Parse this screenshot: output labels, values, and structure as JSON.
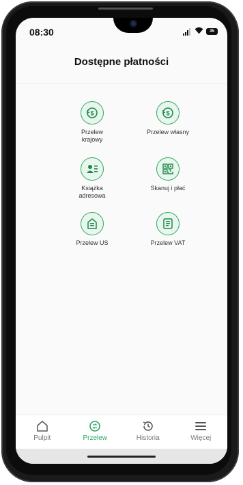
{
  "status_bar": {
    "time": "08:30",
    "battery": "35"
  },
  "header": {
    "title": "Dostępne płatności"
  },
  "tiles": [
    {
      "label": "Przelew\nkrajowy",
      "icon": "dollar-refresh-icon"
    },
    {
      "label": "Przelew własny",
      "icon": "dollar-refresh-icon"
    },
    {
      "label": "Książka\nadresowa",
      "icon": "contact-card-icon"
    },
    {
      "label": "Skanuj i płać",
      "icon": "qr-code-icon"
    },
    {
      "label": "Przelew US",
      "icon": "tax-office-icon"
    },
    {
      "label": "Przelew VAT",
      "icon": "document-icon"
    }
  ],
  "bottom_nav": [
    {
      "label": "Pulpit",
      "icon": "home-icon",
      "active": false
    },
    {
      "label": "Przelew",
      "icon": "transfer-icon",
      "active": true
    },
    {
      "label": "Historia",
      "icon": "history-icon",
      "active": false
    },
    {
      "label": "Więcej",
      "icon": "menu-icon",
      "active": false
    }
  ],
  "colors": {
    "accent": "#2fa862",
    "accent_bg": "#e8f6ee",
    "text": "#111111"
  }
}
